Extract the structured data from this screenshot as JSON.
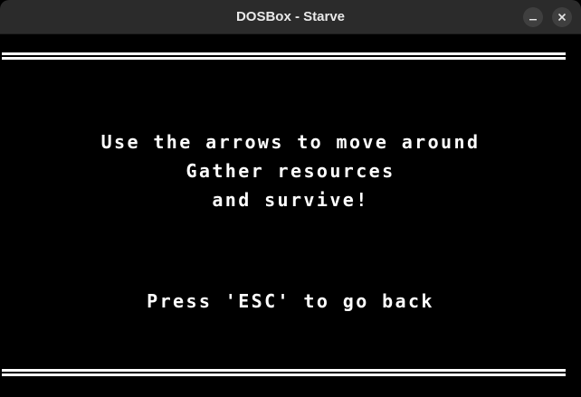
{
  "window": {
    "title": "DOSBox - Starve",
    "minimize_icon": "minimize-icon",
    "close_icon": "close-icon"
  },
  "game_screen": {
    "instructions": [
      "Use the arrows to move around",
      "Gather resources",
      "and survive!"
    ],
    "back_prompt": "Press 'ESC' to go back"
  },
  "colors": {
    "titlebar_bg": "#2b2b2b",
    "screen_bg": "#000000",
    "text": "#ffffff"
  }
}
